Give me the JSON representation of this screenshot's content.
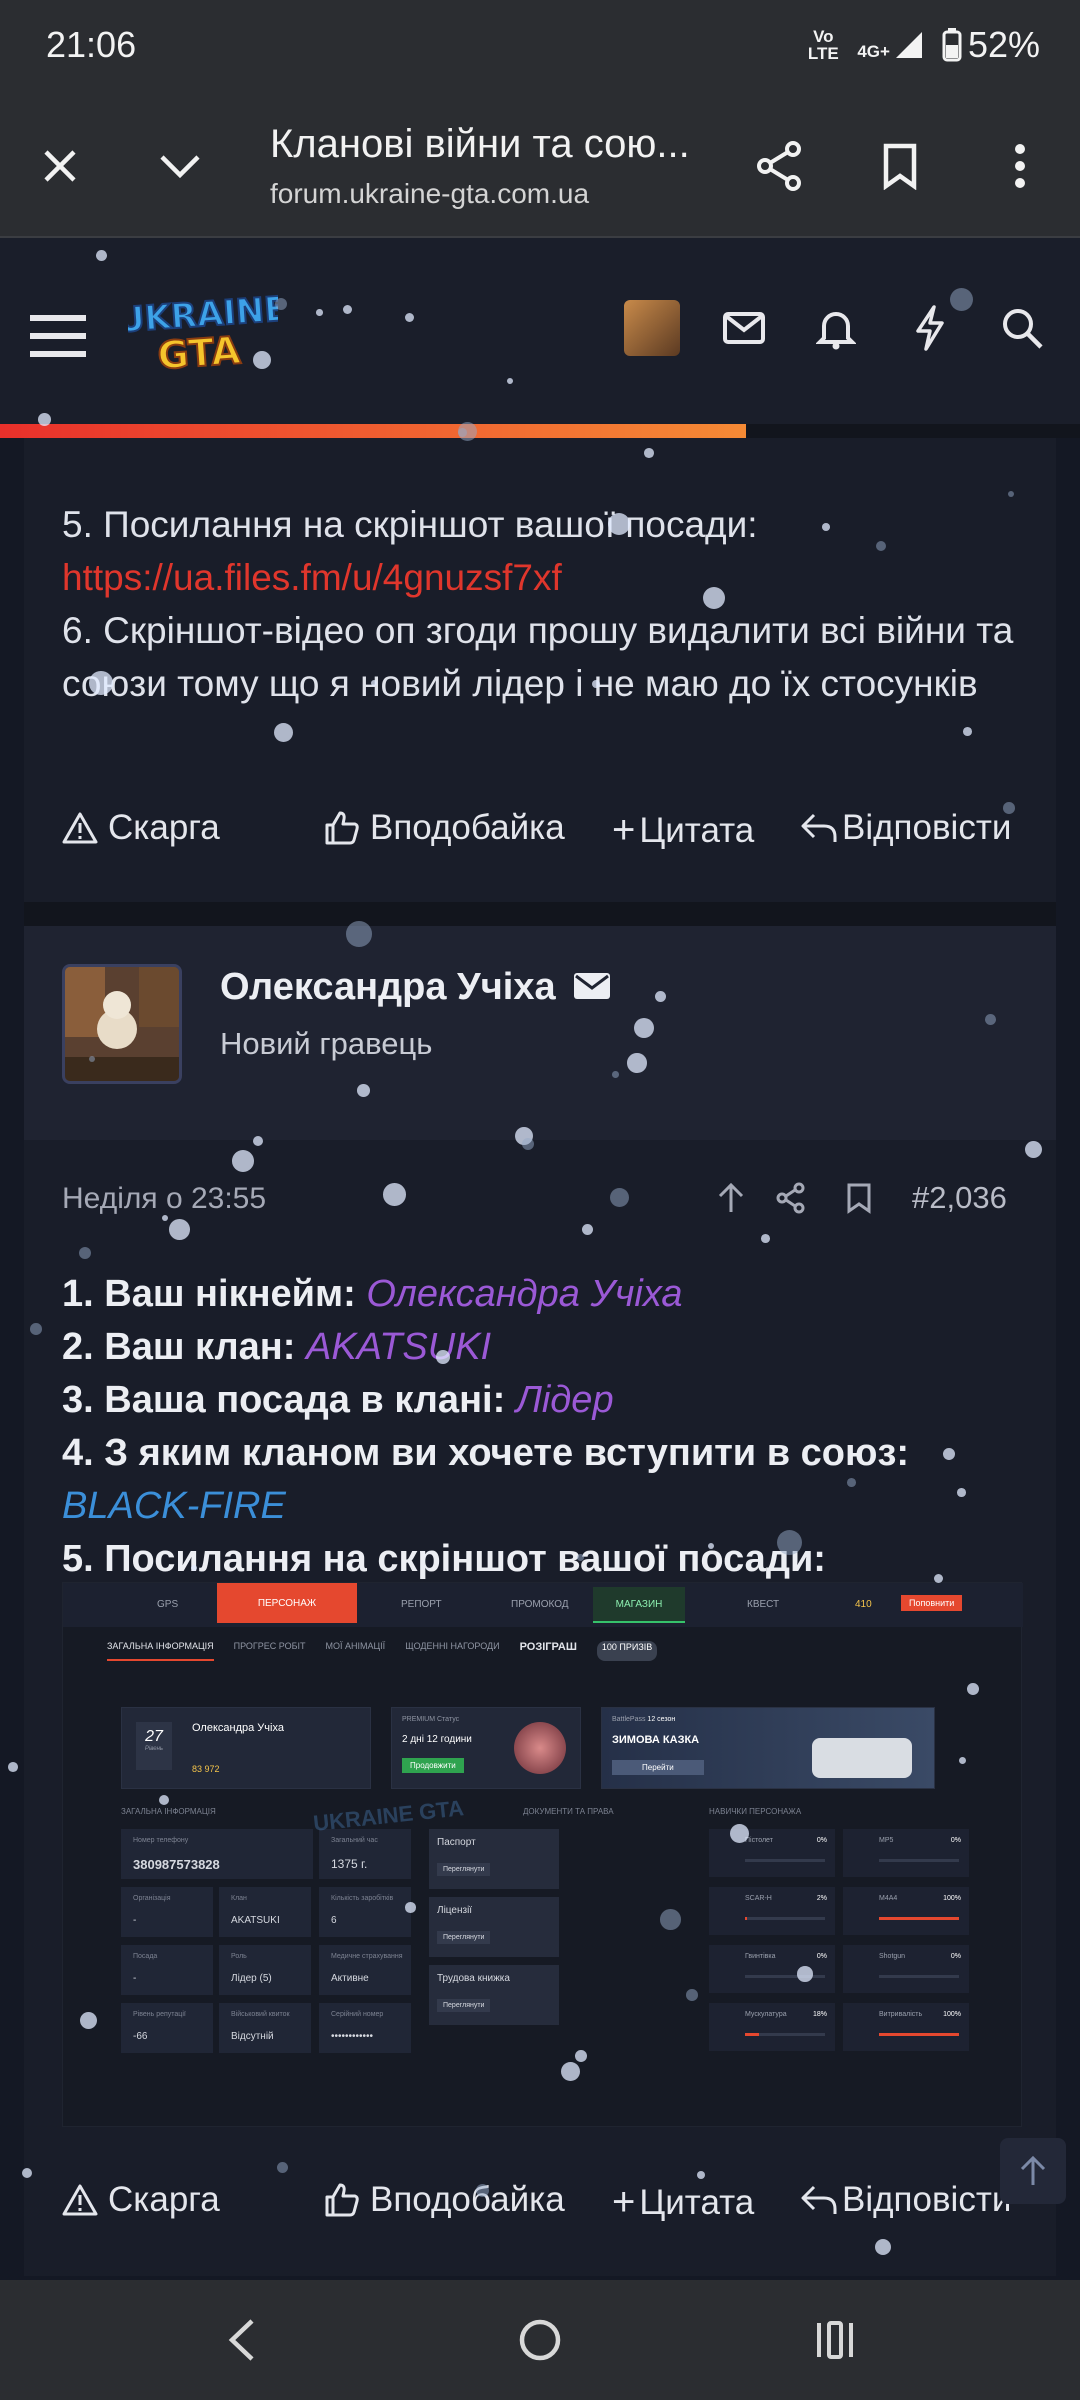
{
  "status_bar": {
    "time": "21:06",
    "volte": "Vo LTE",
    "network": "4G+",
    "battery": "52%"
  },
  "browser": {
    "title": "Кланові війни та сою...",
    "url": "forum.ukraine-gta.com.ua"
  },
  "site": {
    "logo_top": "UKRAINE",
    "logo_bottom": "GTA"
  },
  "post1": {
    "line5": "5. Посилання на скріншот вашої посади:",
    "link": "https://ua.files.fm/u/4gnuzsf7xf",
    "line6": "6. Скріншот-відео оп згоди прошу видалити всі війни та союзи тому що я новий лідер і не маю до їх стосунків"
  },
  "actions": {
    "report": "Скарга",
    "like": "Вподобайка",
    "quote": "Цитата",
    "reply": "Відповісти"
  },
  "post2": {
    "author": "Олександра Учіха",
    "role": "Новий гравець",
    "date": "Неділя о 23:55",
    "number": "#2,036",
    "q1": "1. Ваш нікнейм:",
    "a1": "Олександра Учіха",
    "q2": "2. Ваш клан",
    "a2": "AKATSUKI",
    "q3": "3. Ваша посада в клані",
    "a3": "Лідер",
    "q4": "4. З яким кланом ви хочете вступити в союз:",
    "a4": "BLACK-FIRE",
    "q5": "5. Посилання на скріншот вашої посади:"
  },
  "screenshot": {
    "tabs": [
      "GPS",
      "ПЕРСОНАЖ",
      "РЕПОРТ",
      "ПРОМОКОД",
      "МАГАЗИН",
      "КВЕСТ"
    ],
    "balance": "410",
    "topup": "Поповнити",
    "subtabs": [
      "ЗАГАЛЬНА ІНФОРМАЦІЯ",
      "ПРОГРЕС РОБІТ",
      "МОЇ АНІМАЦІЇ",
      "ЩОДЕННІ НАГОРОДИ"
    ],
    "raffle": "РОЗІГРАШ",
    "raffle_badge": "100 ПРИЗІВ",
    "player_name": "Олександра Учіха",
    "level": "27",
    "level_label": "Рівень",
    "money": "83 972",
    "premium_title": "PREMIUM Статус",
    "premium_value": "2 дні 12 години",
    "extend": "Продовжити",
    "battlepass": "BattlePass",
    "season": "12 сезон",
    "event": "ЗИМОВА КАЗКА",
    "go": "Перейти",
    "section_general": "ЗАГАЛЬНА ІНФОРМАЦІЯ",
    "section_docs": "ДОКУМЕНТИ ТА ПРАВА",
    "section_skills": "НАВИЧКИ ПЕРСОНАЖА",
    "fields": [
      {
        "label": "Номер телефону",
        "value": "380987573828"
      },
      {
        "label": "Загальний час",
        "value": "1375 г."
      },
      {
        "label": "Організація",
        "value": "-"
      },
      {
        "label": "Клан",
        "value": "AKATSUKI"
      },
      {
        "label": "Кількість заробітків",
        "value": "6"
      },
      {
        "label": "Посада",
        "value": "-"
      },
      {
        "label": "Роль",
        "value": "Лідер (5)"
      },
      {
        "label": "Медичне страхування",
        "value": "Активне"
      },
      {
        "label": "Рівень репутації",
        "value": "-66"
      },
      {
        "label": "Військовий квиток",
        "value": "Відсутній"
      },
      {
        "label": "Серійний номер",
        "value": "••••••••••••"
      }
    ],
    "docs": [
      "Паспорт",
      "Ліцензії",
      "Трудова книжка"
    ],
    "view": "Переглянути",
    "skills": [
      {
        "name": "Пістолет",
        "value": "0%"
      },
      {
        "name": "MP5",
        "value": "0%"
      },
      {
        "name": "SCAR-H",
        "value": "2%"
      },
      {
        "name": "M4A4",
        "value": "100%"
      },
      {
        "name": "Гвинтівка",
        "value": "0%"
      },
      {
        "name": "Shotgun",
        "value": "0%"
      },
      {
        "name": "Мускулатура",
        "value": "18%"
      },
      {
        "name": "Витривалість",
        "value": "100%"
      }
    ],
    "watermark": "UKRAINE GTA"
  }
}
